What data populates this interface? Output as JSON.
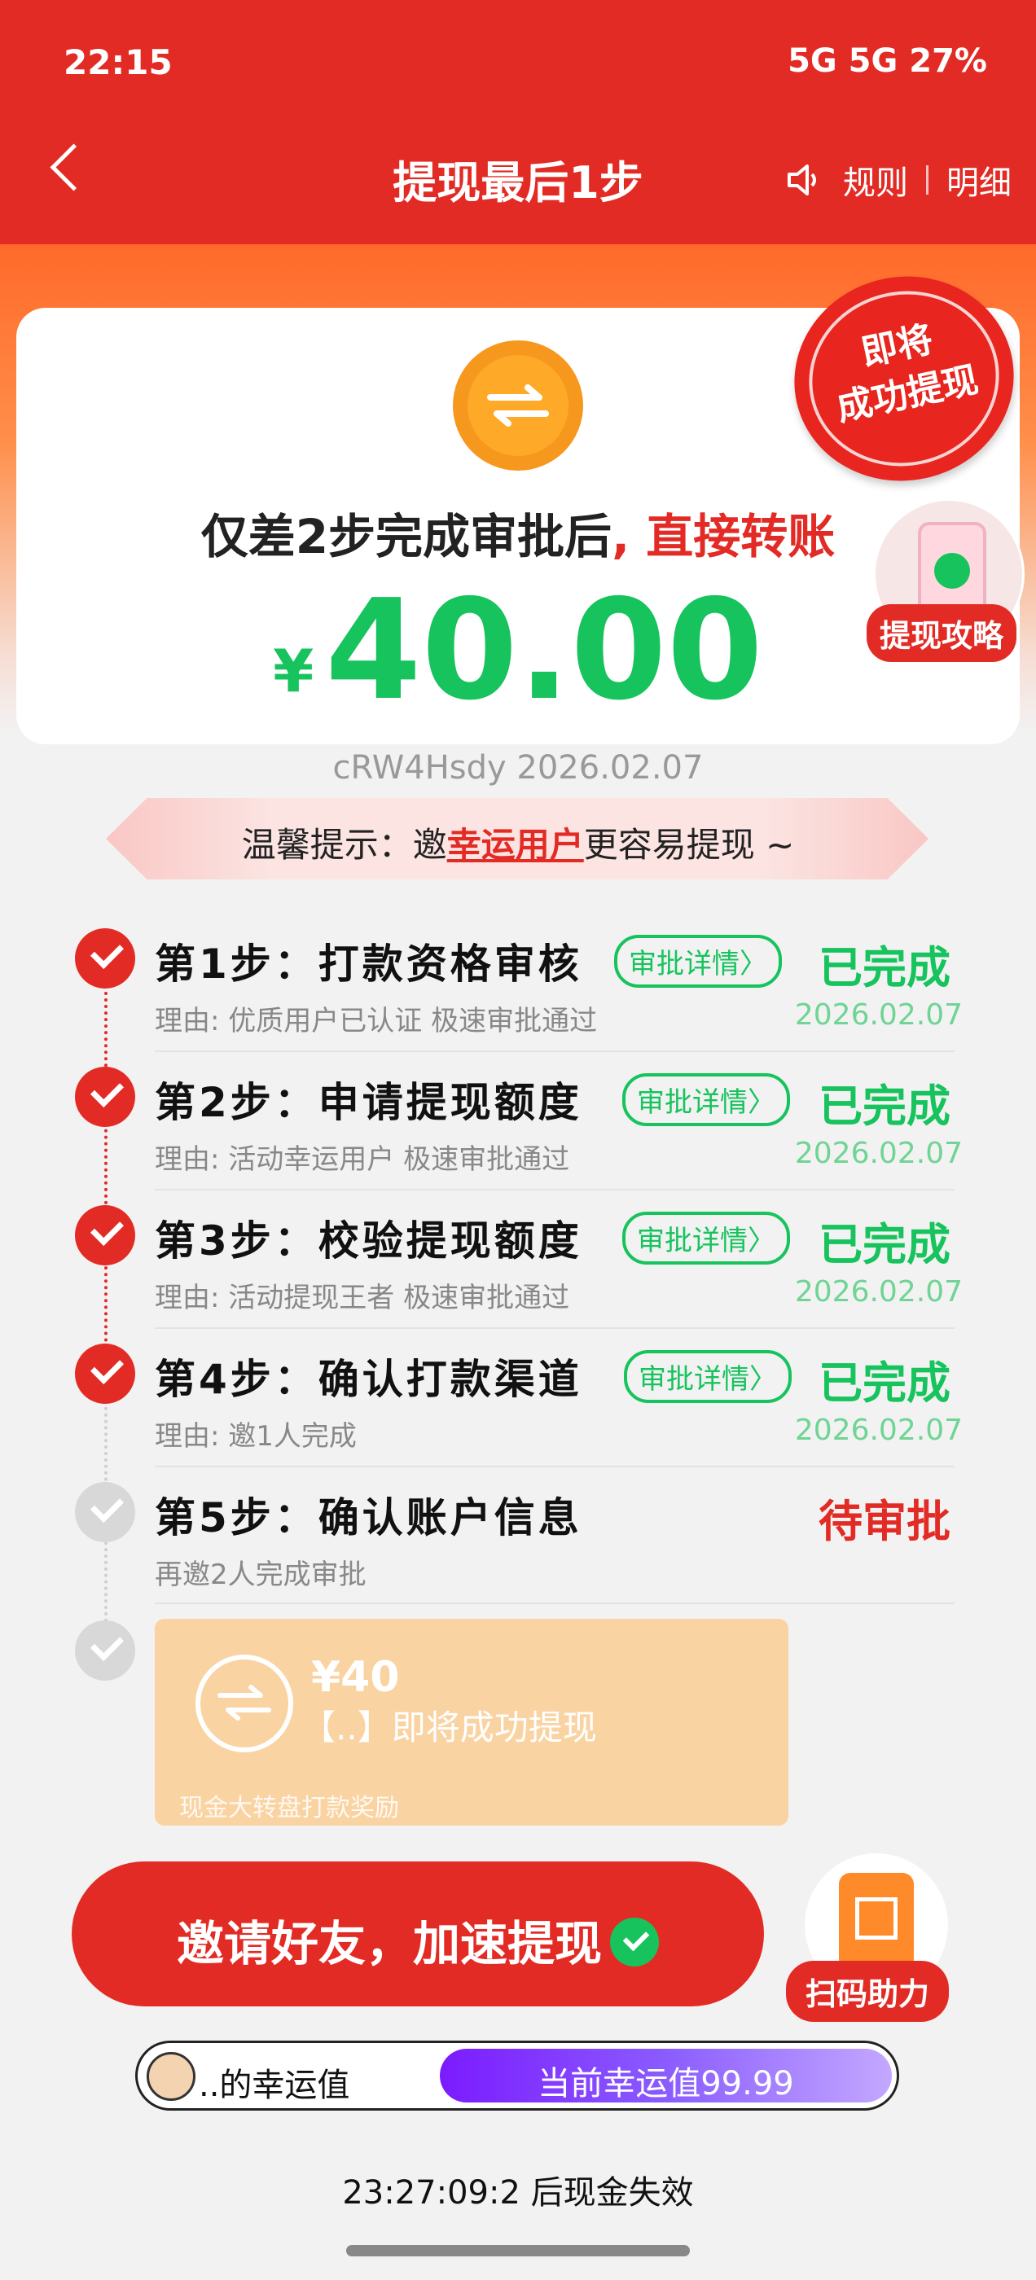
{
  "status_bar": {
    "time": "22:15",
    "right": "5G 5G 27%"
  },
  "header": {
    "title": "提现最后1步",
    "rules": "规则",
    "details": "明细"
  },
  "card": {
    "line_black": "仅差2步完成审批后",
    "line_red": ", 直接转账",
    "currency": "¥",
    "amount": "40.00"
  },
  "seal": {
    "line1": "即将",
    "line2": "成功提现"
  },
  "tip": {
    "label": "提现攻略"
  },
  "code": "cRW4Hsdy 2026.02.07",
  "hint": {
    "prefix": "温馨提示：邀",
    "highlight": "幸运用户",
    "suffix": "更容易提现 ~"
  },
  "steps": [
    {
      "title": "第1步：打款资格审核",
      "pill": "审批详情〉",
      "status": "已完成",
      "reason": "理由: 优质用户已认证 极速审批通过",
      "date": "2026.02.07"
    },
    {
      "title": "第2步：申请提现额度",
      "pill": "审批详情〉",
      "status": "已完成",
      "reason": "理由: 活动幸运用户 极速审批通过",
      "date": "2026.02.07"
    },
    {
      "title": "第3步：校验提现额度",
      "pill": "审批详情〉",
      "status": "已完成",
      "reason": "理由: 活动提现王者 极速审批通过",
      "date": "2026.02.07"
    },
    {
      "title": "第4步：确认打款渠道",
      "pill": "审批详情〉",
      "status": "已完成",
      "reason": "理由: 邀1人完成",
      "date": "2026.02.07"
    },
    {
      "title": "第5步：确认账户信息",
      "status": "待审批",
      "reason": "再邀2人完成审批"
    }
  ],
  "reward": {
    "amount": "¥40",
    "text": "【..】即将成功提现",
    "footer": "现金大转盘打款奖励"
  },
  "invite_button": "邀请好友，加速提现",
  "scan_label": "扫码助力",
  "luck": {
    "name": "..的幸运值",
    "value": "当前幸运值99.99"
  },
  "countdown": "23:27:09:2 后现金失效",
  "colors": {
    "brand_red": "#e32b25",
    "green": "#17c35d",
    "orange": "#f7981e",
    "purple": "#7b1bff"
  }
}
